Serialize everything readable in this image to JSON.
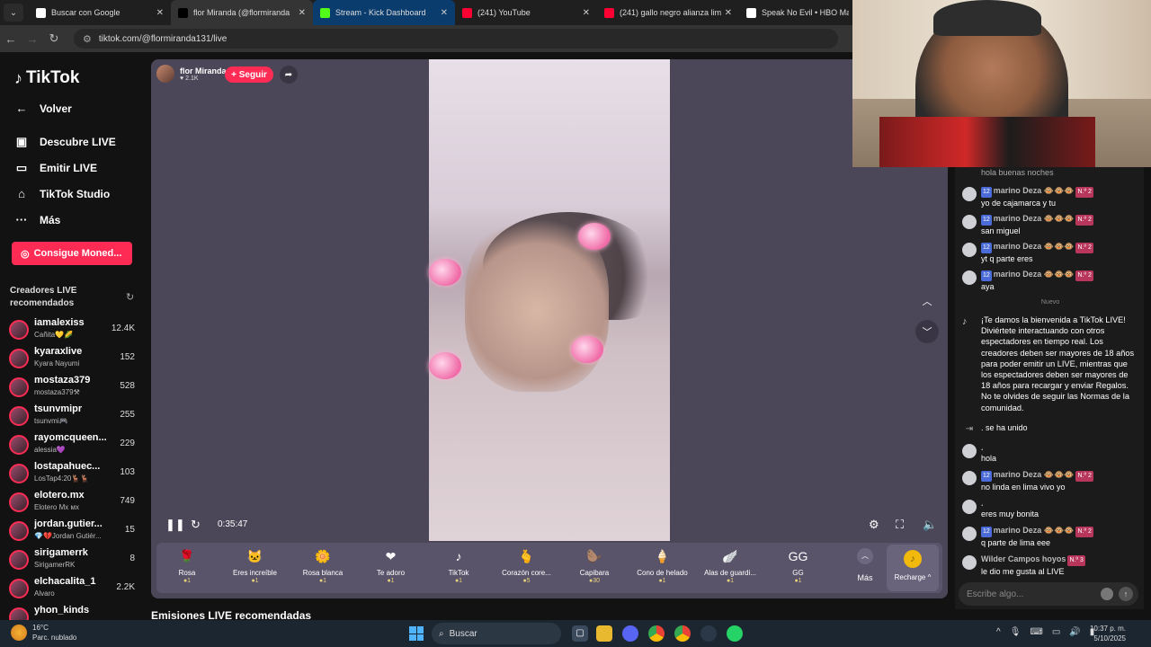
{
  "tabs": [
    {
      "title": "Buscar con Google",
      "icon": "google-icon",
      "color": "#ffffff"
    },
    {
      "title": "flor Miranda (@flormiranda",
      "icon": "tiktok-icon",
      "color": "#000000"
    },
    {
      "title": "Stream - Kick Dashboard",
      "icon": "kick-icon",
      "color": "#53fc18"
    },
    {
      "title": "(241) YouTube",
      "icon": "youtube-icon",
      "color": "#ff0033"
    },
    {
      "title": "(241) gallo negro alianza lima -",
      "icon": "youtube-icon",
      "color": "#ff0033"
    },
    {
      "title": "Speak No Evil • HBO Max",
      "icon": "hbo-icon",
      "color": "#ffffff"
    }
  ],
  "address": {
    "url": "tiktok.com/@flormiranda131/live"
  },
  "sidebar": {
    "brand": "TikTok",
    "back": "Volver",
    "nav": [
      {
        "label": "Descubre LIVE",
        "icon": "live-icon"
      },
      {
        "label": "Emitir LIVE",
        "icon": "camera-icon"
      },
      {
        "label": "TikTok Studio",
        "icon": "home-icon"
      },
      {
        "label": "Más",
        "icon": "more-icon"
      }
    ],
    "coins_button": "Consigue Moned...",
    "rec_title": "Creadores LIVE recomendados",
    "creators": [
      {
        "name": "iamalexiss",
        "sub": "Cañita💛🌽",
        "count": "12.4K"
      },
      {
        "name": "kyaraxlive",
        "sub": "Kyara Nayumi",
        "count": "152"
      },
      {
        "name": "mostaza379",
        "sub": "mostaza379⚒",
        "count": "528"
      },
      {
        "name": "tsunvmipr",
        "sub": "tsunvmi🎮",
        "count": "255"
      },
      {
        "name": "rayomcqueen...",
        "sub": "alessia💜",
        "count": "229"
      },
      {
        "name": "lostapahuec...",
        "sub": "LosTap4:20🦌🦌",
        "count": "103"
      },
      {
        "name": "elotero.mx",
        "sub": "Elotero Mx ᴍx",
        "count": "749"
      },
      {
        "name": "jordan.gutier...",
        "sub": "💎💔Jordan Gutiér...",
        "count": "15"
      },
      {
        "name": "sirigamerrk",
        "sub": "SirigamerRK",
        "count": "8"
      },
      {
        "name": "elchacalita_1",
        "sub": "Alvaro",
        "count": "2.2K"
      },
      {
        "name": "yhon_kinds",
        "sub": "",
        "count": ""
      }
    ]
  },
  "player": {
    "host_name": "flor Miranda",
    "host_likes": "♥ 2.1K",
    "follow": "+ Seguir",
    "time": "0:35:47",
    "gifts": [
      {
        "name": "Rosa",
        "price": "●1",
        "icon": "🌹"
      },
      {
        "name": "Eres increíble",
        "price": "●1",
        "icon": "🐱"
      },
      {
        "name": "Rosa blanca",
        "price": "●1",
        "icon": "🌼"
      },
      {
        "name": "Te adoro",
        "price": "●1",
        "icon": "❤"
      },
      {
        "name": "TikTok",
        "price": "●1",
        "icon": "♪"
      },
      {
        "name": "Corazón core...",
        "price": "●5",
        "icon": "🫰"
      },
      {
        "name": "Capibara",
        "price": "●30",
        "icon": "🦫"
      },
      {
        "name": "Cono de helado",
        "price": "●1",
        "icon": "🍦"
      },
      {
        "name": "Alas de guardi...",
        "price": "●1",
        "icon": "🪽"
      },
      {
        "name": "GG",
        "price": "●1",
        "icon": "GG"
      }
    ],
    "more": "Más",
    "recharge": "Recharge ^"
  },
  "section_heading": "Emisiones LIVE recomendadas",
  "chat": {
    "top_partial": "hola buenas noches",
    "messages": [
      {
        "level": "12",
        "user": "marino Deza",
        "emotes": "🐵🐵🐵",
        "fan": "N.º 2",
        "text": "yo de cajamarca y tu"
      },
      {
        "level": "12",
        "user": "marino Deza",
        "emotes": "🐵🐵🐵",
        "fan": "N.º 2",
        "text": "san miguel"
      },
      {
        "level": "12",
        "user": "marino Deza",
        "emotes": "🐵🐵🐵",
        "fan": "N.º 2",
        "text": "yt q parte eres"
      },
      {
        "level": "12",
        "user": "marino Deza",
        "emotes": "🐵🐵🐵",
        "fan": "N.º 2",
        "text": "aya"
      }
    ],
    "nuevo": "Nuevo",
    "welcome": "¡Te damos la bienvenida a TikTok LIVE! Diviértete interactuando con otros espectadores en tiempo real. Los creadores deben ser mayores de 18 años para poder emitir un LIVE, mientras que los espectadores deben ser mayores de 18 años para recargar y enviar Regalos. No te olvides de seguir las Normas de la comunidad.",
    "joined": ". se ha unido",
    "later": [
      {
        "user": ".",
        "text": "hola"
      },
      {
        "level": "12",
        "user": "marino Deza",
        "emotes": "🐵🐵🐵",
        "fan": "N.º 2",
        "text": "no linda en lima vivo yo"
      },
      {
        "user": ".",
        "text": "eres muy bonita"
      },
      {
        "level": "12",
        "user": "marino Deza",
        "emotes": "🐵🐵🐵",
        "fan": "N.º 2",
        "text": "q parte de lima eee"
      },
      {
        "user": "Wilder Campos hoyos",
        "fan": "N.º 3",
        "text": "le dio me gusta al LIVE"
      }
    ],
    "input_placeholder": "Escribe algo..."
  },
  "taskbar": {
    "temp": "16°C",
    "weather": "Parc. nublado",
    "search": "Buscar",
    "time": "10:37 p. m.",
    "date": "5/10/2025"
  },
  "colors": {
    "accent": "#fe2c55",
    "player_bg": "#4c4758",
    "chat_bg": "#1b1b1b"
  }
}
